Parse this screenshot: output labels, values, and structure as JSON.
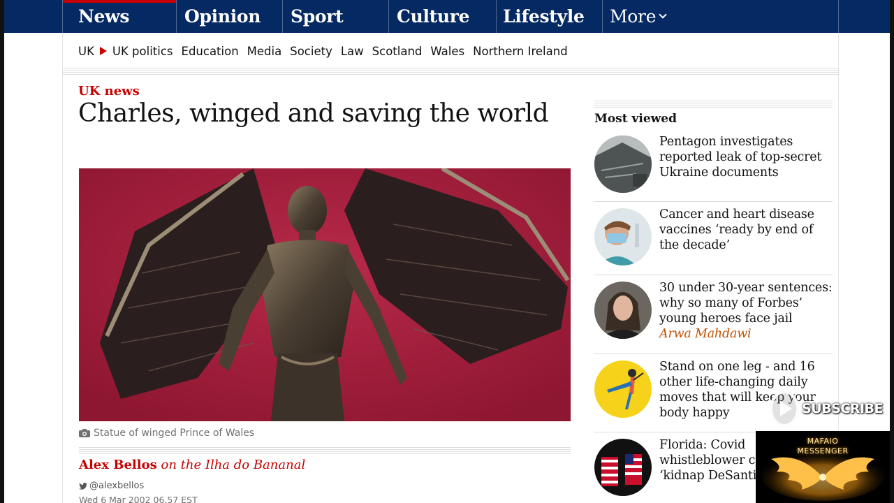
{
  "nav": {
    "pillars": [
      "News",
      "Opinion",
      "Sport",
      "Culture",
      "Lifestyle"
    ],
    "more_label": "More"
  },
  "subnav": {
    "items": [
      "UK",
      "UK politics",
      "Education",
      "Media",
      "Society",
      "Law",
      "Scotland",
      "Wales",
      "Northern Ireland"
    ]
  },
  "article": {
    "kicker": "UK news",
    "headline": "Charles, winged and saving the world",
    "caption": "Statue of winged Prince of Wales",
    "author": "Alex Bellos",
    "author_suffix": "on the Ilha do Bananal",
    "twitter": "@alexbellos",
    "date": "Wed 6 Mar 2002 06.57 EST"
  },
  "most_viewed": {
    "title": "Most viewed",
    "items": [
      {
        "text": "Pentagon investigates reported leak of top-secret Ukraine documents",
        "author": ""
      },
      {
        "text": "Cancer and heart disease vaccines ‘ready by end of the decade’",
        "author": ""
      },
      {
        "text": "30 under 30-year sentences: why so many of Forbes’ young heroes face jail",
        "author": "Arwa Mahdawi"
      },
      {
        "text": "Stand on one leg - and 16 other life-changing daily moves that will keep your body happy",
        "author": ""
      },
      {
        "text": "Florida: Covid whistleblower c arrest is ‘kidnap DeSantis",
        "author": ""
      }
    ]
  },
  "overlay": {
    "subscribe_label": "SUBSCRIBE",
    "channel_line1": "MAFAIO",
    "channel_line2": "MESSENGER"
  },
  "colors": {
    "nav_bg": "#052962",
    "accent_red": "#c70000",
    "opinion_orange": "#c05303"
  }
}
